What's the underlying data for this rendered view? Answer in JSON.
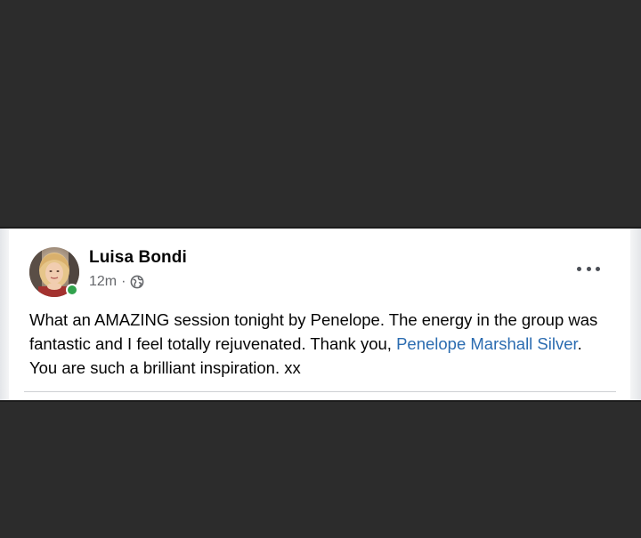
{
  "post": {
    "author_name": "Luisa Bondi",
    "timestamp": "12m",
    "meta_separator": "·",
    "privacy_icon": "globe-icon",
    "online_status_color": "#31a24c",
    "text_part1": "What an AMAZING session tonight by Penelope. The energy in the group was fantastic and I feel totally rejuvenated. Thank you, ",
    "mention": "Penelope Marshall Silver",
    "text_part2": ". You are such a brilliant inspiration. xx",
    "more_icon": "more-options-icon"
  },
  "colors": {
    "mention": "#2a6bb0",
    "background_bars": "#2c2c2c",
    "card": "#ffffff"
  }
}
